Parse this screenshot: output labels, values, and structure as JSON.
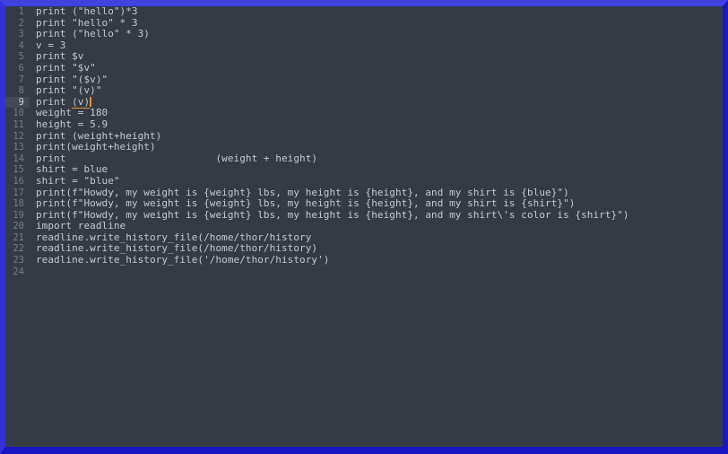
{
  "window": {
    "kind": "code-editor",
    "border_color_top": "#3f41e0",
    "border_color_left": "#3531d6",
    "border_color_right": "#1c17c4",
    "border_color_bottom": "#1a14c2",
    "background_color": "#343b45",
    "gutter_text_color": "#777e8a",
    "code_text_color": "#c4cad3",
    "current_line_highlight_color": "#434a55",
    "caret_color": "#e8932c"
  },
  "editor": {
    "current_line_number": 9,
    "total_lines": 24,
    "lines": [
      {
        "number": "1",
        "text": "print (\"hello\")*3"
      },
      {
        "number": "2",
        "text": "print \"hello\" * 3"
      },
      {
        "number": "3",
        "text": "print (\"hello\" * 3)"
      },
      {
        "number": "4",
        "text": "v = 3"
      },
      {
        "number": "5",
        "text": "print $v"
      },
      {
        "number": "6",
        "text": "print \"$v\""
      },
      {
        "number": "7",
        "text": "print \"($v)\""
      },
      {
        "number": "8",
        "text": "print \"(v)\""
      },
      {
        "number": "9",
        "text": "print (v)"
      },
      {
        "number": "10",
        "text": "weight = 180"
      },
      {
        "number": "11",
        "text": "height = 5.9"
      },
      {
        "number": "12",
        "text": "print (weight+height)"
      },
      {
        "number": "13",
        "text": "print(weight+height)"
      },
      {
        "number": "14",
        "text": "print                         (weight + height)"
      },
      {
        "number": "15",
        "text": "shirt = blue"
      },
      {
        "number": "16",
        "text": "shirt = \"blue\""
      },
      {
        "number": "17",
        "text": "print(f\"Howdy, my weight is {weight} lbs, my height is {height}, and my shirt is {blue}\")"
      },
      {
        "number": "18",
        "text": "print(f\"Howdy, my weight is {weight} lbs, my height is {height}, and my shirt is {shirt}\")"
      },
      {
        "number": "19",
        "text": "print(f\"Howdy, my weight is {weight} lbs, my height is {height}, and my shirt\\'s color is {shirt}\")"
      },
      {
        "number": "20",
        "text": "import readline"
      },
      {
        "number": "21",
        "text": "readline.write_history_file(/home/thor/history"
      },
      {
        "number": "22",
        "text": "readline.write_history_file(/home/thor/history)"
      },
      {
        "number": "23",
        "text": "readline.write_history_file('/home/thor/history')"
      },
      {
        "number": "24",
        "text": ""
      }
    ],
    "active_line": {
      "prefix": "print ",
      "paren_match": "(v)",
      "suffix": ""
    }
  }
}
